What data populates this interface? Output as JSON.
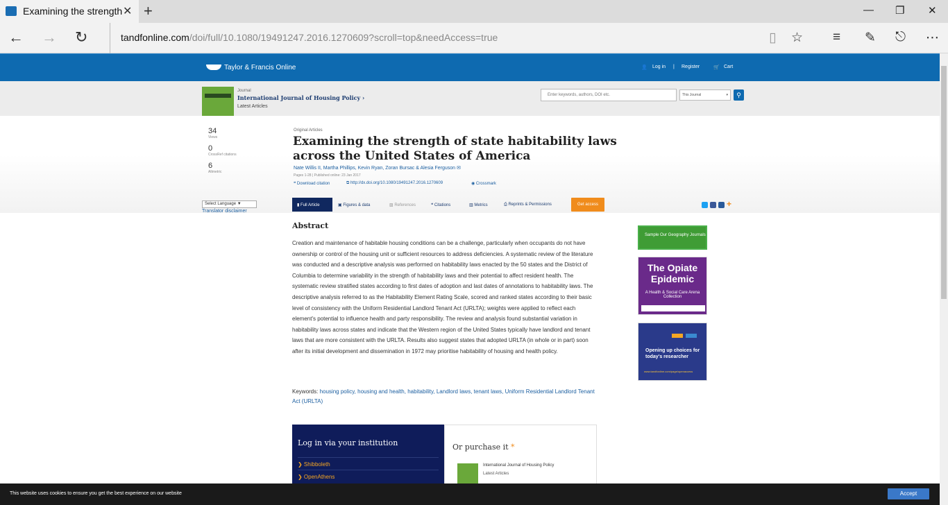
{
  "browser": {
    "tab_title": "Examining the strength",
    "url_domain": "tandfonline.com",
    "url_path": "/doi/full/10.1080/19491247.2016.1270609?scroll=top&needAccess=true"
  },
  "site": {
    "logo_text": "Taylor & Francis Online",
    "login": "Log in",
    "register": "Register",
    "cart": "Cart"
  },
  "journal": {
    "label": "Journal",
    "title": "International Journal of Housing Policy ›",
    "latest": "Latest Articles",
    "search_placeholder": "Enter keywords, authors, DOI etc.",
    "search_scope": "This Journal"
  },
  "metrics": [
    {
      "value": "34",
      "label": "Views"
    },
    {
      "value": "0",
      "label": "CrossRef citations"
    },
    {
      "value": "6",
      "label": "Altmetric"
    }
  ],
  "article": {
    "type": "Original Articles",
    "title": "Examining the strength of state habitability laws across the United States of America",
    "authors": "Nate Willis II, Martha Phillips, Kevin Ryan, Zoran Bursac & Alesia Ferguson ✉",
    "pages": "Pages 1-28 | Published online: 23 Jan 2017",
    "download": "❝ Download citation",
    "doi": "⧉ http://dx.doi.org/10.1080/19491247.2016.1270609",
    "crossmark": "◉ Crossmark"
  },
  "translate": {
    "select": "Select Language ▼",
    "disclaimer": "Translator disclaimer"
  },
  "tabs": {
    "full": "▮ Full Article",
    "figures": "▣ Figures & data",
    "references": "▨ References",
    "citations": "❝ Citations",
    "metrics": "▥ Metrics",
    "reprints": "⎙ Reprints & Permissions",
    "access": "Get access"
  },
  "abstract": {
    "heading": "Abstract",
    "text": "Creation and maintenance of habitable housing conditions can be a challenge, particularly when occupants do not have ownership or control of the housing unit or sufficient resources to address deficiencies. A systematic review of the literature was conducted and a descriptive analysis was performed on habitability laws enacted by the 50 states and the District of Columbia to determine variability in the strength of habitability laws and their potential to affect resident health. The systematic review stratified states according to first dates of adoption and last dates of annotations to habitability laws. The descriptive analysis referred to as the Habitability Element Rating Scale, scored and ranked states according to their basic level of consistency with the Uniform Residential Landlord Tenant Act (URLTA); weights were applied to reflect each element's potential to influence health and party responsibility. The review and analysis found substantial variation in habitability laws across states and indicate that the Western region of the United States typically have landlord and tenant laws that are more consistent with the URLTA. Results also suggest states that adopted URLTA (in whole or in part) soon after its initial development and dissemination in 1972 may prioritise habitability of housing and health policy."
  },
  "keywords": {
    "label": "Keywords: ",
    "items": "housing policy, housing and health, habitability, Landlord laws, tenant laws, Uniform Residential Landlord Tenant Act (URLTA)"
  },
  "access_box": {
    "login_title": "Log in via your institution",
    "shibboleth": "❯  Shibboleth",
    "openathens": "❯  OpenAthens",
    "purchase_title": "Or purchase it",
    "purchase_star": " *",
    "purchase_journal": "International Journal of Housing Policy",
    "purchase_latest": "Latest Articles"
  },
  "ads": {
    "ad1": "Sample Our Geography Journals",
    "ad2_title": "The Opiate Epidemic",
    "ad2_sub": "A Health & Social Care Arena Collection",
    "ad3_title": "Opening up choices for today's researcher",
    "ad3_url": "www.tandfonline.com/page/openaccess"
  },
  "cookie": {
    "text": "This website uses cookies to ensure you get the best experience on our website",
    "accept": "Accept"
  }
}
